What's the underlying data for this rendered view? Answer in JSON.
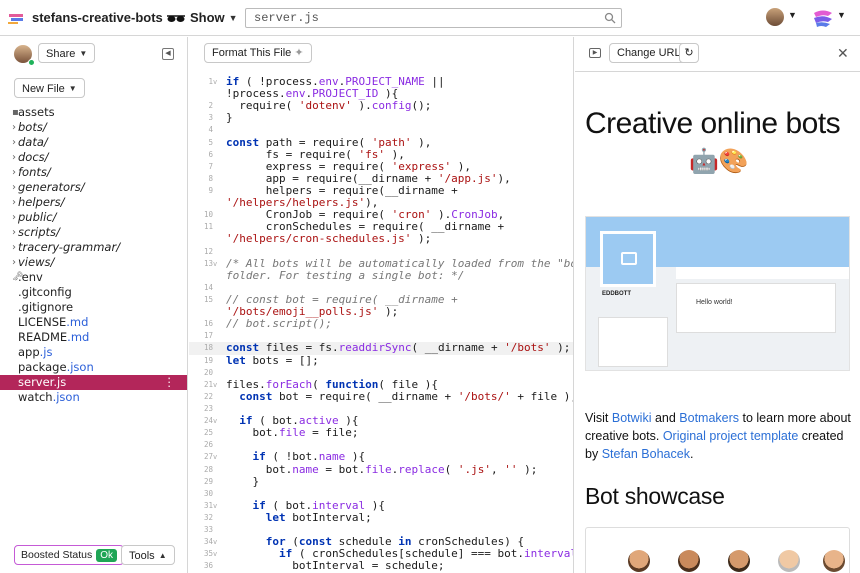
{
  "topbar": {
    "project_name": "stefans-creative-bots",
    "show_label": "Show",
    "search_value": "server.js"
  },
  "sidebar": {
    "share_label": "Share",
    "new_file_label": "New File",
    "files": [
      {
        "name": "assets",
        "ext": "",
        "type": "folder-plain"
      },
      {
        "name": "bots/",
        "ext": "",
        "type": "dir"
      },
      {
        "name": "data/",
        "ext": "",
        "type": "dir"
      },
      {
        "name": "docs/",
        "ext": "",
        "type": "dir"
      },
      {
        "name": "fonts/",
        "ext": "",
        "type": "dir"
      },
      {
        "name": "generators/",
        "ext": "",
        "type": "dir"
      },
      {
        "name": "helpers/",
        "ext": "",
        "type": "dir"
      },
      {
        "name": "public/",
        "ext": "",
        "type": "dir"
      },
      {
        "name": "scripts/",
        "ext": "",
        "type": "dir"
      },
      {
        "name": "tracery-grammar/",
        "ext": "",
        "type": "dir"
      },
      {
        "name": "views/",
        "ext": "",
        "type": "dir"
      },
      {
        "name": ".env",
        "ext": "",
        "type": "env"
      },
      {
        "name": ".gitconfig",
        "ext": "",
        "type": "file"
      },
      {
        "name": ".gitignore",
        "ext": "",
        "type": "file"
      },
      {
        "name": "LICENSE",
        "ext": ".md",
        "type": "file"
      },
      {
        "name": "README",
        "ext": ".md",
        "type": "file"
      },
      {
        "name": "app",
        "ext": ".js",
        "type": "file"
      },
      {
        "name": "package",
        "ext": ".json",
        "type": "file"
      },
      {
        "name": "server",
        "ext": ".js",
        "type": "selected"
      },
      {
        "name": "watch",
        "ext": ".json",
        "type": "file"
      }
    ],
    "boosted_label": "Boosted Status",
    "boosted_badge": "Ok",
    "tools_label": "Tools"
  },
  "editor": {
    "format_label": "Format This File",
    "lines": [
      {
        "n": "1",
        "f": "v",
        "t": "if ( !process.env.PROJECT_NAME ||"
      },
      {
        "n": "",
        "f": "",
        "t": "!process.env.PROJECT_ID ){"
      },
      {
        "n": "2",
        "f": "",
        "t": "  require( 'dotenv' ).config();"
      },
      {
        "n": "3",
        "f": "",
        "t": "}"
      },
      {
        "n": "4",
        "f": "",
        "t": ""
      },
      {
        "n": "5",
        "f": "",
        "t": "const path = require( 'path' ),"
      },
      {
        "n": "6",
        "f": "",
        "t": "      fs = require( 'fs' ),"
      },
      {
        "n": "7",
        "f": "",
        "t": "      express = require( 'express' ),"
      },
      {
        "n": "8",
        "f": "",
        "t": "      app = require(__dirname + '/app.js'),"
      },
      {
        "n": "9",
        "f": "",
        "t": "      helpers = require(__dirname +"
      },
      {
        "n": "",
        "f": "",
        "t": "'/helpers/helpers.js'),"
      },
      {
        "n": "10",
        "f": "",
        "t": "      CronJob = require( 'cron' ).CronJob,"
      },
      {
        "n": "11",
        "f": "",
        "t": "      cronSchedules = require( __dirname +"
      },
      {
        "n": "",
        "f": "",
        "t": "'/helpers/cron-schedules.js' );"
      },
      {
        "n": "12",
        "f": "",
        "t": ""
      },
      {
        "n": "13",
        "f": "v",
        "t": "/* All bots will be automatically loaded from the \"bots\""
      },
      {
        "n": "",
        "f": "",
        "t": "folder. For testing a single bot: */"
      },
      {
        "n": "14",
        "f": "",
        "t": ""
      },
      {
        "n": "15",
        "f": "",
        "t": "// const bot = require( __dirname +"
      },
      {
        "n": "",
        "f": "",
        "t": "'/bots/emoji__polls.js' );"
      },
      {
        "n": "16",
        "f": "",
        "t": "// bot.script();"
      },
      {
        "n": "17",
        "f": "",
        "t": ""
      },
      {
        "n": "18",
        "f": "",
        "t": "const files = fs.readdirSync( __dirname + '/bots' );"
      },
      {
        "n": "19",
        "f": "",
        "t": "let bots = [];"
      },
      {
        "n": "20",
        "f": "",
        "t": ""
      },
      {
        "n": "21",
        "f": "v",
        "t": "files.forEach( function( file ){"
      },
      {
        "n": "22",
        "f": "",
        "t": "  const bot = require( __dirname + '/bots/' + file );"
      },
      {
        "n": "23",
        "f": "",
        "t": ""
      },
      {
        "n": "24",
        "f": "v",
        "t": "  if ( bot.active ){"
      },
      {
        "n": "25",
        "f": "",
        "t": "    bot.file = file;"
      },
      {
        "n": "26",
        "f": "",
        "t": ""
      },
      {
        "n": "27",
        "f": "v",
        "t": "    if ( !bot.name ){"
      },
      {
        "n": "28",
        "f": "",
        "t": "      bot.name = bot.file.replace( '.js', '' );"
      },
      {
        "n": "29",
        "f": "",
        "t": "    }"
      },
      {
        "n": "30",
        "f": "",
        "t": ""
      },
      {
        "n": "31",
        "f": "v",
        "t": "    if ( bot.interval ){"
      },
      {
        "n": "32",
        "f": "",
        "t": "      let botInterval;"
      },
      {
        "n": "33",
        "f": "",
        "t": ""
      },
      {
        "n": "34",
        "f": "v",
        "t": "      for (const schedule in cronSchedules) {"
      },
      {
        "n": "35",
        "f": "v",
        "t": "        if ( cronSchedules[schedule] === bot.interval ){"
      },
      {
        "n": "36",
        "f": "",
        "t": "          botInterval = schedule;"
      }
    ]
  },
  "preview": {
    "change_url_label": "Change URL",
    "title": "Creative online bots",
    "title_emoji": "🤖🎨",
    "shot_name": "EDDBOTT",
    "shot_hello": "Hello world!",
    "para_1": "Visit ",
    "link_botwiki": "Botwiki",
    "para_2": " and ",
    "link_botmakers": "Botmakers",
    "para_3": " to learn more about creative bots. ",
    "link_template": "Original project template",
    "para_4": " created by ",
    "link_author": "Stefan Bohacek",
    "para_5": ".",
    "section_title": "Bot showcase"
  },
  "colors": {
    "selected_file_bg": "#b3265a",
    "link": "#2b6fd6",
    "ok_badge": "#1fa556"
  }
}
